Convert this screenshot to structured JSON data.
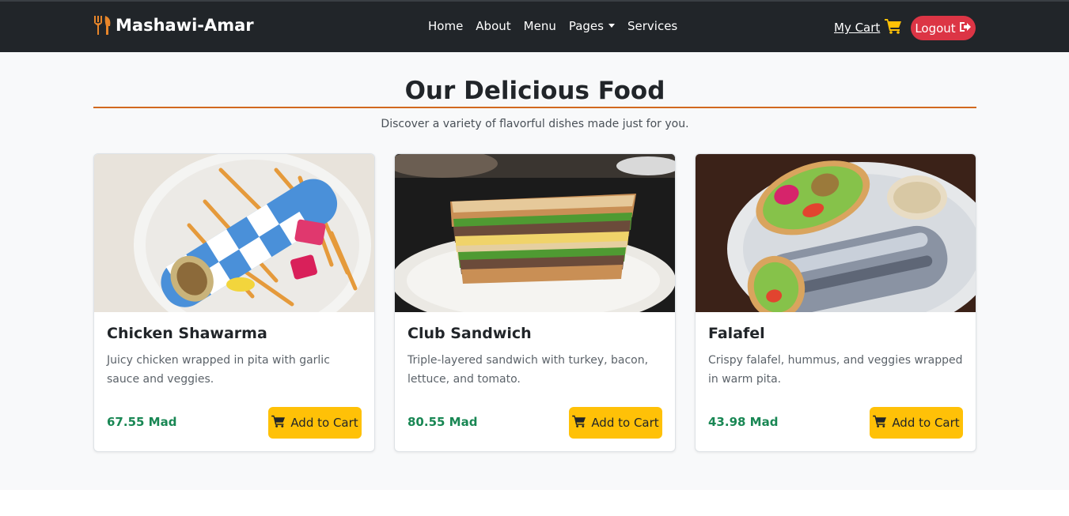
{
  "navbar": {
    "brand": "Mashawi-Amar",
    "brand_icon": "utensils-icon",
    "links": [
      "Home",
      "About",
      "Menu",
      "Pages",
      "Services"
    ],
    "cart_label": "My Cart",
    "cart_icon": "cart-icon",
    "logout_label": "Logout",
    "logout_icon": "sign-out-icon"
  },
  "section": {
    "title": "Our Delicious Food",
    "subtitle": "Discover a variety of flavorful dishes made just for you."
  },
  "items": [
    {
      "name": "Chicken Shawarma",
      "description": "Juicy chicken wrapped in pita with garlic sauce and veggies.",
      "price": "67.55 Mad",
      "button": "Add to Cart"
    },
    {
      "name": "Club Sandwich",
      "description": "Triple-layered sandwich with turkey, bacon, lettuce, and tomato.",
      "price": "80.55 Mad",
      "button": "Add to Cart"
    },
    {
      "name": "Falafel",
      "description": "Crispy falafel, hummus, and veggies wrapped in warm pita.",
      "price": "43.98 Mad",
      "button": "Add to Cart"
    }
  ],
  "colors": {
    "navbar_bg": "#212529",
    "accent_rule": "#d2691e",
    "brand_icon": "#e8862a",
    "cart_icon": "#ffc107",
    "logout_bg": "#dc3545",
    "price": "#198754",
    "add_button": "#ffc107"
  }
}
